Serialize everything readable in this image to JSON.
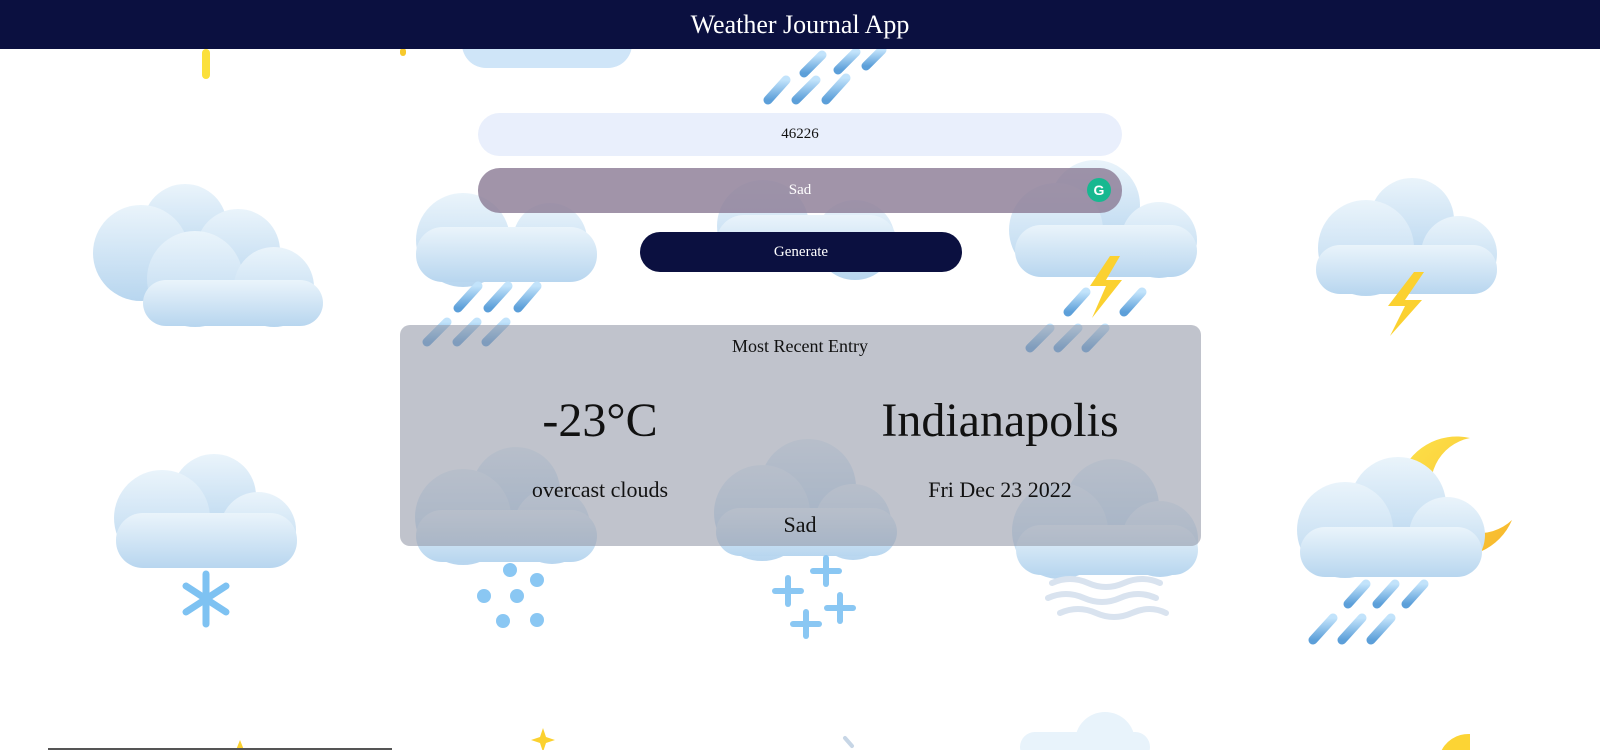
{
  "header": {
    "title": "Weather Journal App"
  },
  "form": {
    "zip_value": "46226",
    "feelings_value": "Sad",
    "generate_label": "Generate"
  },
  "entry": {
    "title": "Most Recent Entry",
    "temp": "-23°C",
    "city": "Indianapolis",
    "description": "overcast clouds",
    "date": "Fri Dec 23 2022",
    "content": "Sad"
  },
  "background": {
    "icons": [
      "cloud-icon",
      "rain-cloud-icon",
      "heavy-rain-icon",
      "storm-cloud-icon",
      "lightning-cloud-icon",
      "snow-cloud-icon",
      "hail-cloud-icon",
      "sleet-cloud-icon",
      "fog-cloud-icon",
      "night-rain-icon",
      "sun-icon",
      "star-icon"
    ],
    "colors": {
      "cloud_light": "#eef6fc",
      "cloud_dark": "#b3d3ee",
      "rain": "#6fb3ec",
      "bolt": "#f9cf2e",
      "moon": "#fcd434",
      "header": "#0b1040"
    }
  }
}
